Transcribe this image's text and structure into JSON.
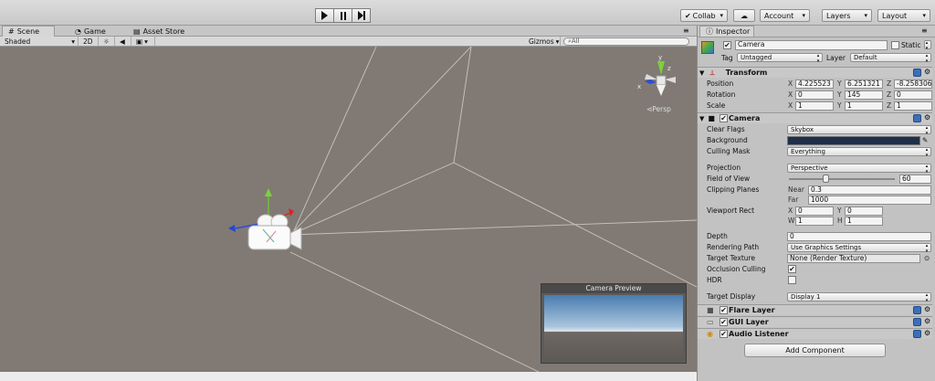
{
  "toolbar": {
    "collab": "Collab",
    "account": "Account",
    "layers": "Layers",
    "layout": "Layout"
  },
  "scene_tabs": [
    "Scene",
    "Game",
    "Asset Store"
  ],
  "scene_toolbar": {
    "shading": "Shaded",
    "mode_2d": "2D",
    "gizmos": "Gizmos",
    "search_placeholder": "All"
  },
  "scene_view": {
    "persp_label": "Persp"
  },
  "camera_preview": {
    "title": "Camera Preview"
  },
  "inspector": {
    "tab": "Inspector",
    "object_name": "Camera",
    "static_label": "Static",
    "tag_label": "Tag",
    "tag_value": "Untagged",
    "layer_label": "Layer",
    "layer_value": "Default",
    "transform": {
      "title": "Transform",
      "position_label": "Position",
      "rotation_label": "Rotation",
      "scale_label": "Scale",
      "position": {
        "x": "4.225523",
        "y": "6.251321",
        "z": "-8.258306"
      },
      "rotation": {
        "x": "0",
        "y": "145",
        "z": "0"
      },
      "scale": {
        "x": "1",
        "y": "1",
        "z": "1"
      }
    },
    "camera": {
      "title": "Camera",
      "clear_flags_label": "Clear Flags",
      "clear_flags": "Skybox",
      "background_label": "Background",
      "background_color": "#1e2f4a",
      "culling_mask_label": "Culling Mask",
      "culling_mask": "Everything",
      "projection_label": "Projection",
      "projection": "Perspective",
      "fov_label": "Field of View",
      "fov": "60",
      "fov_fraction": 0.33,
      "clipping_label": "Clipping Planes",
      "near_label": "Near",
      "near": "0.3",
      "far_label": "Far",
      "far": "1000",
      "viewport_label": "Viewport Rect",
      "vp_x": "0",
      "vp_y": "0",
      "vp_w": "1",
      "vp_h": "1",
      "depth_label": "Depth",
      "depth": "0",
      "rendering_path_label": "Rendering Path",
      "rendering_path": "Use Graphics Settings",
      "target_texture_label": "Target Texture",
      "target_texture": "None (Render Texture)",
      "occlusion_label": "Occlusion Culling",
      "hdr_label": "HDR",
      "target_display_label": "Target Display",
      "target_display": "Display 1"
    },
    "components": [
      "Flare Layer",
      "GUI Layer",
      "Audio Listener"
    ],
    "add_component": "Add Component"
  }
}
